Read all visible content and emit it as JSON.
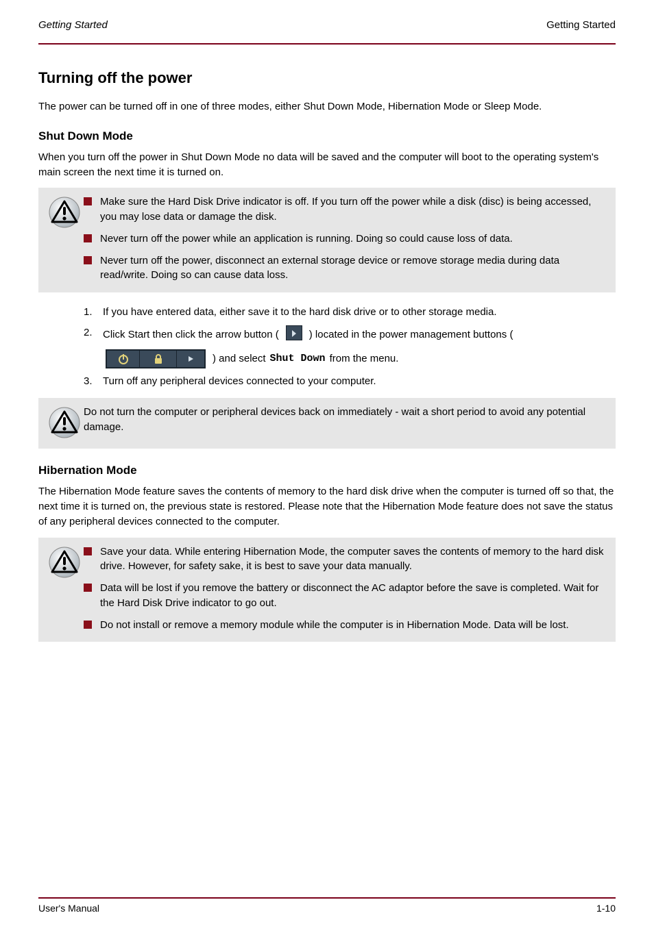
{
  "header": {
    "left": "Getting Started",
    "right": "Getting Started"
  },
  "section_title": "Turning off the power",
  "intro": "The power can be turned off in one of three modes, either Shut Down Mode, Hibernation Mode or Sleep Mode.",
  "shutdown": {
    "title": "Shut Down Mode",
    "para": "When you turn off the power in Shut Down Mode no data will be saved and the computer will boot to the operating system's main screen the next time it is turned on.",
    "callout_items": [
      "Make sure the Hard Disk Drive indicator is off. If you turn off the power while a disk (disc) is being accessed, you may lose data or damage the disk.",
      "Never turn off the power while an application is running. Doing so could cause loss of data.",
      "Never turn off the power, disconnect an external storage device or remove storage media during data read/write. Doing so can cause data loss."
    ],
    "steps": {
      "s1": "If you have entered data, either save it to the hard disk drive or to other storage media.",
      "s2a": "Click Start then click the arrow button (",
      "s2b": ") located in the power management buttons (",
      "s2c": ") and select ",
      "s2d_cmd": "Shut Down",
      "s2e": " from the menu.",
      "s3": "Turn off any peripheral devices connected to your computer."
    }
  },
  "mid_callout": "Do not turn the computer or peripheral devices back on immediately - wait a short period to avoid any potential damage.",
  "hibernation": {
    "title": "Hibernation Mode",
    "para": "The Hibernation Mode feature saves the contents of memory to the hard disk drive when the computer is turned off so that, the next time it is turned on, the previous state is restored. Please note that the Hibernation Mode feature does not save the status of any peripheral devices connected to the computer.",
    "callout_items": [
      "Save your data. While entering Hibernation Mode, the computer saves the contents of memory to the hard disk drive. However, for safety sake, it is best to save your data manually.",
      "Data will be lost if you remove the battery or disconnect the AC adaptor before the save is completed. Wait for the Hard Disk Drive indicator to go out.",
      "Do not install or remove a memory module while the computer is in Hibernation Mode. Data will be lost."
    ]
  },
  "icons": {
    "warning_title": "warning-icon"
  },
  "footer": {
    "left": "User's Manual",
    "right": "1-10"
  }
}
